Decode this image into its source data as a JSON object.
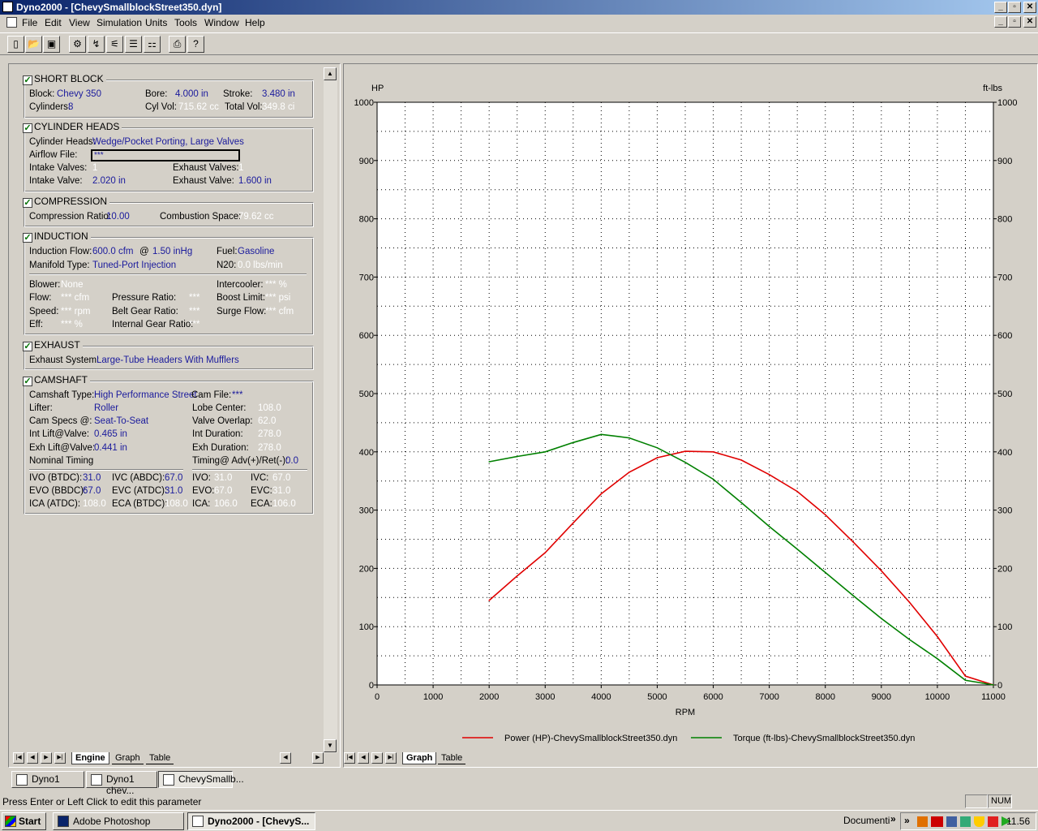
{
  "window": {
    "title": "Dyno2000 - [ChevySmallblockStreet350.dyn]",
    "min": "_",
    "restore": "▫",
    "close": "✕"
  },
  "menu": [
    "File",
    "Edit",
    "View",
    "Simulation",
    "Units",
    "Tools",
    "Window",
    "Help"
  ],
  "short_block": {
    "header": "SHORT BLOCK",
    "block_label": "Block:",
    "block": "Chevy 350",
    "bore_label": "Bore:",
    "bore": "4.000 in",
    "stroke_label": "Stroke:",
    "stroke": "3.480 in",
    "cyl_label": "Cylinders:",
    "cyl": "8",
    "cylvol_label": "Cyl Vol:",
    "cylvol": "715.62 cc",
    "totvol_label": "Total Vol:",
    "totvol": "349.8 ci"
  },
  "cylinder_heads": {
    "header": "CYLINDER HEADS",
    "heads_label": "Cylinder Heads:",
    "heads": "Wedge/Pocket Porting, Large Valves",
    "airflow_label": "Airflow File:",
    "airflow": "***",
    "iv_label": "Intake Valves:",
    "iv": "1",
    "ev_label": "Exhaust Valves:",
    "ev": "1",
    "ivs_label": "Intake Valve:",
    "ivs": "2.020 in",
    "evs_label": "Exhaust Valve:",
    "evs": "1.600 in"
  },
  "compression": {
    "header": "COMPRESSION",
    "cr_label": "Compression Ratio:",
    "cr": "10.00",
    "cs_label": "Combustion Space:",
    "cs": "79.62 cc"
  },
  "induction": {
    "header": "INDUCTION",
    "flow_label": "Induction Flow:",
    "flow": "600.0 cfm",
    "at": "@",
    "vac": "1.50 inHg",
    "fuel_label": "Fuel:",
    "fuel": "Gasoline",
    "manifold_label": "Manifold Type:",
    "manifold": "Tuned-Port Injection",
    "n2o_label": "N20:",
    "n2o": "0.0 lbs/min",
    "blower_label": "Blower:",
    "blower": "None",
    "intercooler_label": "Intercooler:",
    "intercooler": "*** %",
    "flow2_label": "Flow:",
    "flow2": "*** cfm",
    "pr_label": "Pressure Ratio:",
    "pr": "***",
    "boost_label": "Boost Limit:",
    "boost": "*** psi",
    "speed_label": "Speed:",
    "speed": "*** rpm",
    "belt_label": "Belt Gear Ratio:",
    "belt": "***",
    "surge_label": "Surge Flow:",
    "surge": "*** cfm",
    "eff_label": "Eff:",
    "eff": "*** %",
    "igr_label": "Internal Gear Ratio:",
    "igr": "***"
  },
  "exhaust": {
    "header": "EXHAUST",
    "sys_label": "Exhaust System:",
    "sys": "Large-Tube Headers With Mufflers"
  },
  "camshaft": {
    "header": "CAMSHAFT",
    "type_label": "Camshaft Type:",
    "type": "High Performance Street",
    "file_label": "Cam File:",
    "file": "***",
    "lifter_label": "Lifter:",
    "lifter": "Roller",
    "lobe_label": "Lobe Center:",
    "lobe": "108.0",
    "specs_label": "Cam Specs @:",
    "specs": "Seat-To-Seat",
    "overlap_label": "Valve Overlap:",
    "overlap": "62.0",
    "intlift_label": "Int Lift@Valve:",
    "intlift": "0.465 in",
    "intdur_label": "Int Duration:",
    "intdur": "278.0",
    "exhlift_label": "Exh Lift@Valve:",
    "exhlift": "0.441 in",
    "exhdur_label": "Exh Duration:",
    "exhdur": "278.0",
    "nominal": "Nominal Timing",
    "timing_label": "Timing@ Adv(+)/Ret(-):",
    "timing": "0.0",
    "ivo1_label": "IVO  (BTDC):",
    "ivo1": "31.0",
    "ivc1_label": "IVC  (ABDC):",
    "ivc1": "67.0",
    "ivo2_label": "IVO:",
    "ivo2": "31.0",
    "ivc2_label": "IVC:",
    "ivc2": "67.0",
    "evo1_label": "EVO (BBDC):",
    "evo1": "67.0",
    "evc1_label": "EVC (ATDC):",
    "evc1": "31.0",
    "evo2_label": "EVO:",
    "evo2": "67.0",
    "evc2_label": "EVC:",
    "evc2": "31.0",
    "ica1_label": "ICA  (ATDC):",
    "ica1": "108.0",
    "eca1_label": "ECA (BTDC):",
    "eca1": "108.0",
    "ica2_label": "ICA:",
    "ica2": "106.0",
    "eca2_label": "ECA:",
    "eca2": "106.0"
  },
  "left_tabs": [
    "Engine",
    "Graph",
    "Table"
  ],
  "right_tabs": [
    "Graph",
    "Table"
  ],
  "mdi": [
    "Dyno1",
    "Dyno1 chev...",
    "ChevySmallb..."
  ],
  "status": {
    "text": "Press Enter or Left Click to edit this parameter",
    "num": "NUM"
  },
  "taskbar": {
    "start": "Start",
    "items": [
      "Adobe Photoshop",
      "Dyno2000 - [ChevyS..."
    ],
    "documents": "Documenti",
    "clock": "11.56",
    "chevrons": "»"
  },
  "chart_data": {
    "type": "line",
    "xlabel": "RPM",
    "ylabel_left": "HP",
    "ylabel_right": "ft-lbs",
    "xlim": [
      0,
      11000
    ],
    "ylim": [
      0,
      1000
    ],
    "x_ticks": [
      0,
      1000,
      2000,
      3000,
      4000,
      5000,
      6000,
      7000,
      8000,
      9000,
      10000,
      11000
    ],
    "y_ticks": [
      0,
      100,
      200,
      300,
      400,
      500,
      600,
      700,
      800,
      900,
      1000
    ],
    "grid": true,
    "series": [
      {
        "name": "Power (HP)-ChevySmallblockStreet350.dyn",
        "color": "#e00000",
        "x": [
          2000,
          2500,
          3000,
          3500,
          4000,
          4500,
          5000,
          5500,
          6000,
          6500,
          7000,
          7500,
          8000,
          8500,
          9000,
          9500,
          10000,
          10500,
          11000
        ],
        "y": [
          145,
          187,
          227,
          278,
          328,
          365,
          390,
          401,
          400,
          386,
          361,
          332,
          292,
          245,
          196,
          142,
          83,
          15,
          0
        ]
      },
      {
        "name": "Torque (ft-lbs)-ChevySmallblockStreet350.dyn",
        "color": "#008000",
        "x": [
          2000,
          2500,
          3000,
          3500,
          4000,
          4500,
          5000,
          5500,
          6000,
          6500,
          7000,
          7500,
          8000,
          8500,
          9000,
          9500,
          10000,
          10500,
          11000
        ],
        "y": [
          383,
          392,
          400,
          416,
          430,
          424,
          407,
          382,
          353,
          313,
          272,
          233,
          193,
          153,
          114,
          78,
          45,
          8,
          0
        ]
      }
    ],
    "legend": "bottom"
  }
}
